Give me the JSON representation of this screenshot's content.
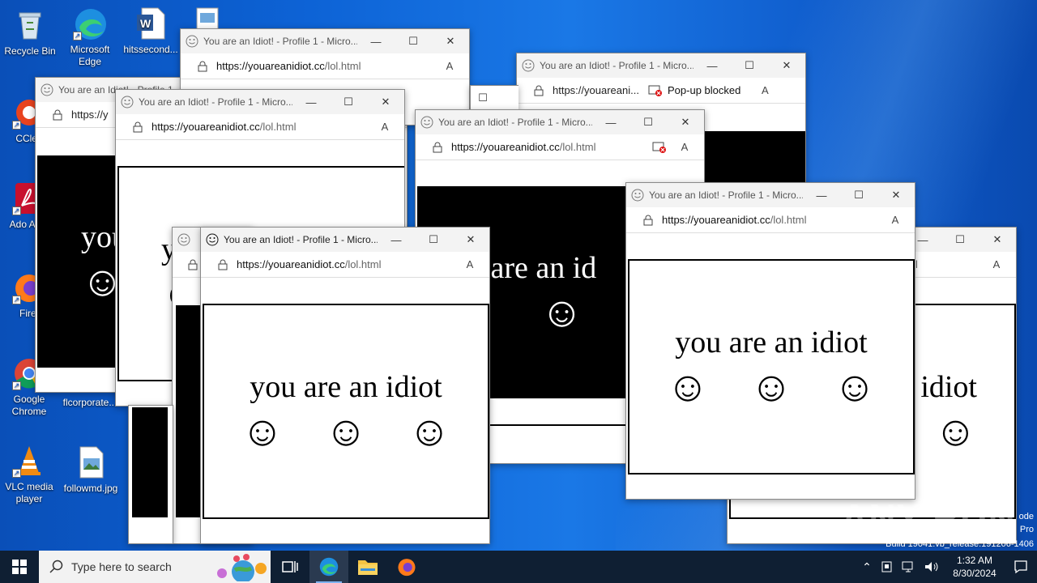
{
  "desktop": {
    "icons": [
      {
        "label": "Recycle Bin"
      },
      {
        "label": "Microsoft Edge"
      },
      {
        "label": "hitssecond..."
      },
      {
        "label": "CClea"
      },
      {
        "label": "Ado Acro"
      },
      {
        "label": "Firef"
      },
      {
        "label": "Google Chrome"
      },
      {
        "label": "flcorporate..."
      },
      {
        "label": "VLC media player"
      },
      {
        "label": "followmd.jpg"
      }
    ],
    "build_text": {
      "line1": "ode",
      "line2": "Pro",
      "line3": "Build 19041.vb_release.191206-1406"
    },
    "watermark": "ANY RUN"
  },
  "browser": {
    "title": "You are an Idiot! - Profile 1 - Micro...",
    "title_short": "You are an Idiot! - Profile 1 - Micro...",
    "url_host": "https://youareanidiot.cc",
    "url_path": "/lol.html",
    "url_truncated": "https://youareani...",
    "url_partial": "https://y",
    "popup_blocked": "Pop-up blocked",
    "read_aloud_icon": "A",
    "page_text": "you are an idiot",
    "page_text_partial1": "you",
    "page_text_partial2": "y",
    "page_text_partial3": "u are an id",
    "page_text_partial4": "idiot",
    "partial_url_tail": "l",
    "smiley": "☺"
  },
  "taskbar": {
    "search_placeholder": "Type here to search",
    "time": "1:32 AM",
    "date": "8/30/2024"
  }
}
